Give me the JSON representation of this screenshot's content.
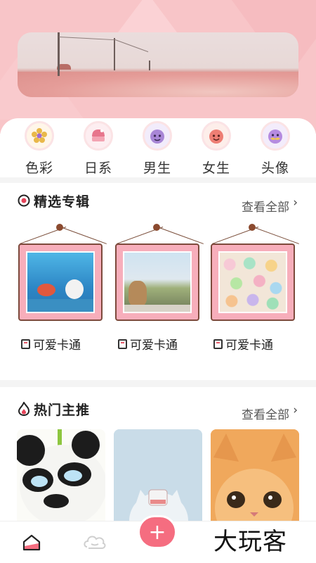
{
  "categories": [
    {
      "label": "色彩",
      "icon": "flower-icon",
      "color": "#e9b84a"
    },
    {
      "label": "日系",
      "icon": "cupcake-icon",
      "color": "#e7758c"
    },
    {
      "label": "男生",
      "icon": "boy-face-icon",
      "color": "#a886d6"
    },
    {
      "label": "女生",
      "icon": "girl-face-icon",
      "color": "#ee7e74"
    },
    {
      "label": "头像",
      "icon": "mustache-face-icon",
      "color": "#b58be0"
    }
  ],
  "featured": {
    "title": "精选专辑",
    "see_all": "查看全部",
    "albums": [
      {
        "label": "可爱卡通",
        "image": "underwater-cartoon"
      },
      {
        "label": "可爱卡通",
        "image": "teddy-bear-window"
      },
      {
        "label": "可爱卡通",
        "image": "candy-bears"
      }
    ]
  },
  "hot": {
    "title": "热门主推",
    "see_all": "查看全部",
    "items": [
      {
        "image": "panda-3d"
      },
      {
        "image": "white-cat-bottle"
      },
      {
        "image": "orange-kitten"
      }
    ]
  },
  "nav": {
    "add_label": "+",
    "watermark": "大玩客"
  },
  "colors": {
    "header_pink": "#f8c5c8",
    "accent": "#f56d80",
    "frame_pink": "#f7aebb"
  }
}
